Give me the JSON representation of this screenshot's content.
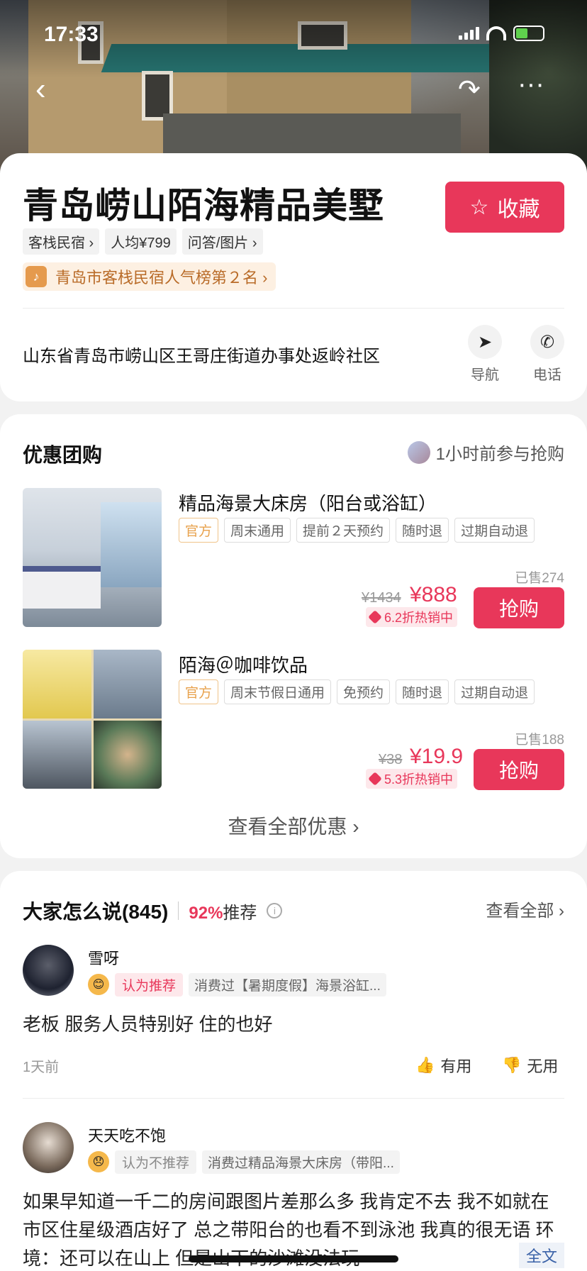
{
  "status": {
    "time": "17:33"
  },
  "hotel": {
    "title": "青岛崂山陌海精品美墅",
    "fav_label": "收藏",
    "tags": [
      "客栈民宿 ›",
      "人均¥799",
      "问答/图片 ›"
    ],
    "rank": "青岛市客栈民宿人气榜第２名 ›",
    "address": "山东省青岛市崂山区王哥庄街道办事处返岭社区",
    "nav_label": "导航",
    "phone_label": "电话"
  },
  "deals": {
    "section_title": "优惠团购",
    "recent": "1小时前参与抢购",
    "items": [
      {
        "name": "精品海景大床房（阳台或浴缸）",
        "chips": [
          "官方",
          "周末通用",
          "提前２天预约",
          "随时退",
          "过期自动退"
        ],
        "sold": "已售274",
        "old_price": "¥1434",
        "price": "¥888",
        "discount": "6.2折热销中",
        "buy": "抢购"
      },
      {
        "name": "陌海＠咖啡饮品",
        "chips": [
          "官方",
          "周末节假日通用",
          "免预约",
          "随时退",
          "过期自动退"
        ],
        "sold": "已售188",
        "old_price": "¥38",
        "price": "¥19.9",
        "discount": "5.3折热销中",
        "buy": "抢购"
      }
    ],
    "see_all": "查看全部优惠 ›"
  },
  "reviews": {
    "title": "大家怎么说(845)",
    "pct": "92%",
    "rec_label": "推荐",
    "view_all": "查看全部 ›",
    "items": [
      {
        "user": "雪呀",
        "verdict": "认为推荐",
        "consumed": "消费过【暑期度假】海景浴缸...",
        "text": "老板 服务人员特别好 住的也好",
        "time": "1天前",
        "useful": "有用",
        "useless": "无用"
      },
      {
        "user": "天天吃不饱",
        "verdict": "认为不推荐",
        "consumed": "消费过精品海景大床房（带阳...",
        "text": "如果早知道一千二的房间跟图片差那么多 我肯定不去 我不如就在市区住星级酒店好了 总之带阳台的也看不到泳池 我真的很无语  环境：还可以在山上 但是山下的沙滩没法玩",
        "full": "全文"
      }
    ]
  },
  "colors": {
    "accent": "#e8375a"
  }
}
